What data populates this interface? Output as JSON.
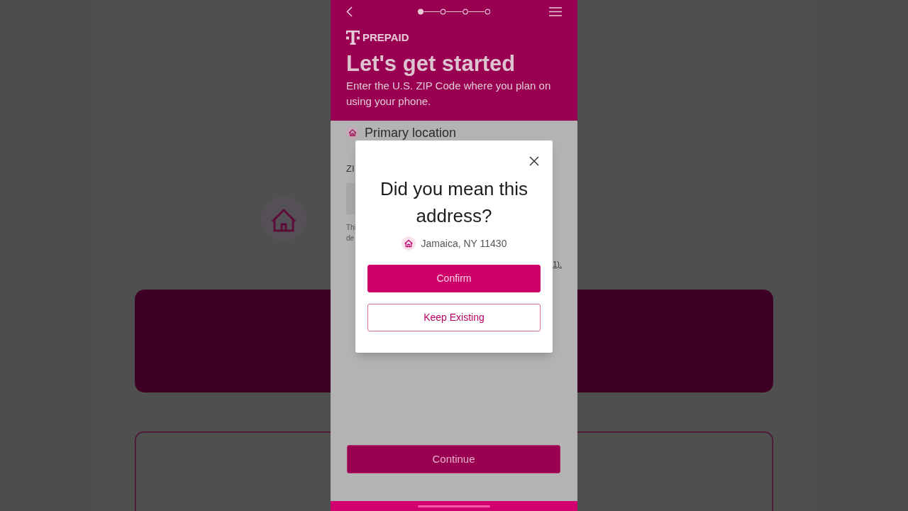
{
  "header": {
    "stepper": {
      "steps": [
        {
          "selected": true
        },
        {
          "selected": false
        },
        {
          "selected": false
        },
        {
          "selected": false
        }
      ]
    },
    "brand": "PREPAID",
    "title": "Let's get started",
    "subtitle": "Enter the U.S. ZIP Code where you plan on using your phone."
  },
  "form": {
    "section_title": "Primary location",
    "field_label": "ZI",
    "note_lines": [
      "Thi",
      "de"
    ],
    "link_fragment": "1)."
  },
  "footer": {
    "continue_button": "Continue"
  },
  "dialog": {
    "title": "Did you mean this address?",
    "address": "Jamaica, NY 11430",
    "buttons": [
      {
        "label": "Confirm",
        "kind": "primary"
      },
      {
        "label": "Keep Existing",
        "kind": "outline"
      }
    ]
  }
}
